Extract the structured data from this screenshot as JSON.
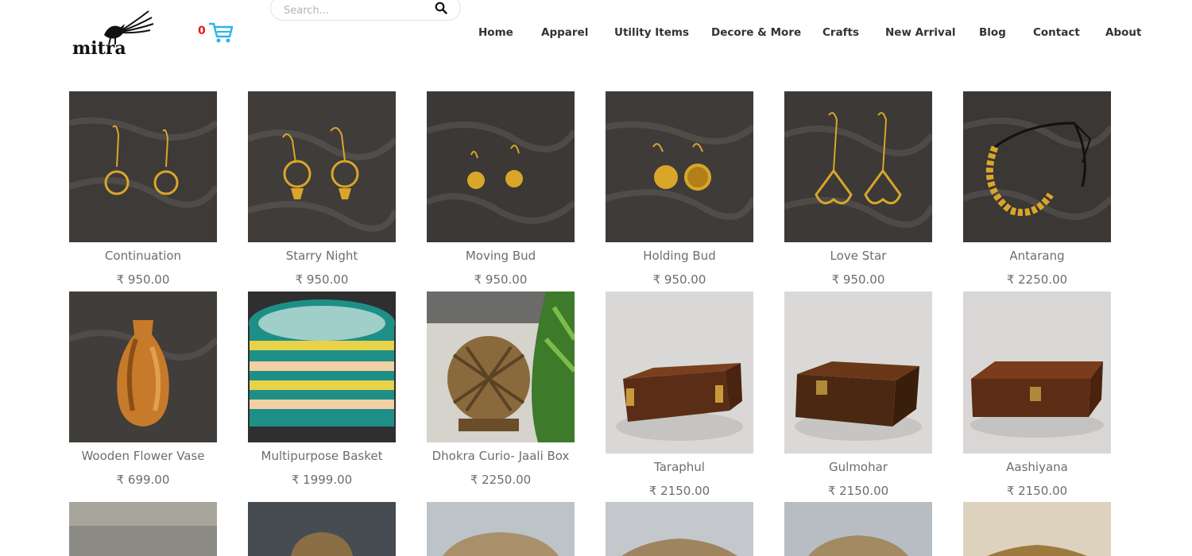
{
  "header": {
    "brand": "mitra",
    "cart_count": "0",
    "search": {
      "placeholder": "Search..."
    }
  },
  "nav": {
    "items": [
      {
        "label": "Home"
      },
      {
        "label": "Apparel"
      },
      {
        "label": "Utility Items"
      },
      {
        "label": "Decore & More"
      },
      {
        "label": "Crafts"
      },
      {
        "label": "New Arrival"
      },
      {
        "label": "Blog"
      },
      {
        "label": "Contact"
      },
      {
        "label": "About"
      }
    ]
  },
  "products": [
    {
      "name": "Continuation",
      "price": "₹ 950.00"
    },
    {
      "name": "Starry Night",
      "price": "₹ 950.00"
    },
    {
      "name": "Moving Bud",
      "price": "₹ 950.00"
    },
    {
      "name": "Holding Bud",
      "price": "₹ 950.00"
    },
    {
      "name": "Love Star",
      "price": "₹ 950.00"
    },
    {
      "name": "Antarang",
      "price": "₹ 2250.00"
    },
    {
      "name": "Wooden Flower Vase",
      "price": "₹ 699.00"
    },
    {
      "name": "Multipurpose Basket",
      "price": "₹ 1999.00"
    },
    {
      "name": "Dhokra Curio- Jaali Box",
      "price": "₹ 2250.00"
    },
    {
      "name": "Taraphul",
      "price": "₹ 2150.00"
    },
    {
      "name": "Gulmohar",
      "price": "₹ 2150.00"
    },
    {
      "name": "Aashiyana",
      "price": "₹ 2150.00"
    }
  ],
  "colors": {
    "accent_cart": "#29b6e8",
    "cart_count": "#e01b1b",
    "nav_text": "#333333",
    "product_text": "#6d6d6d"
  }
}
